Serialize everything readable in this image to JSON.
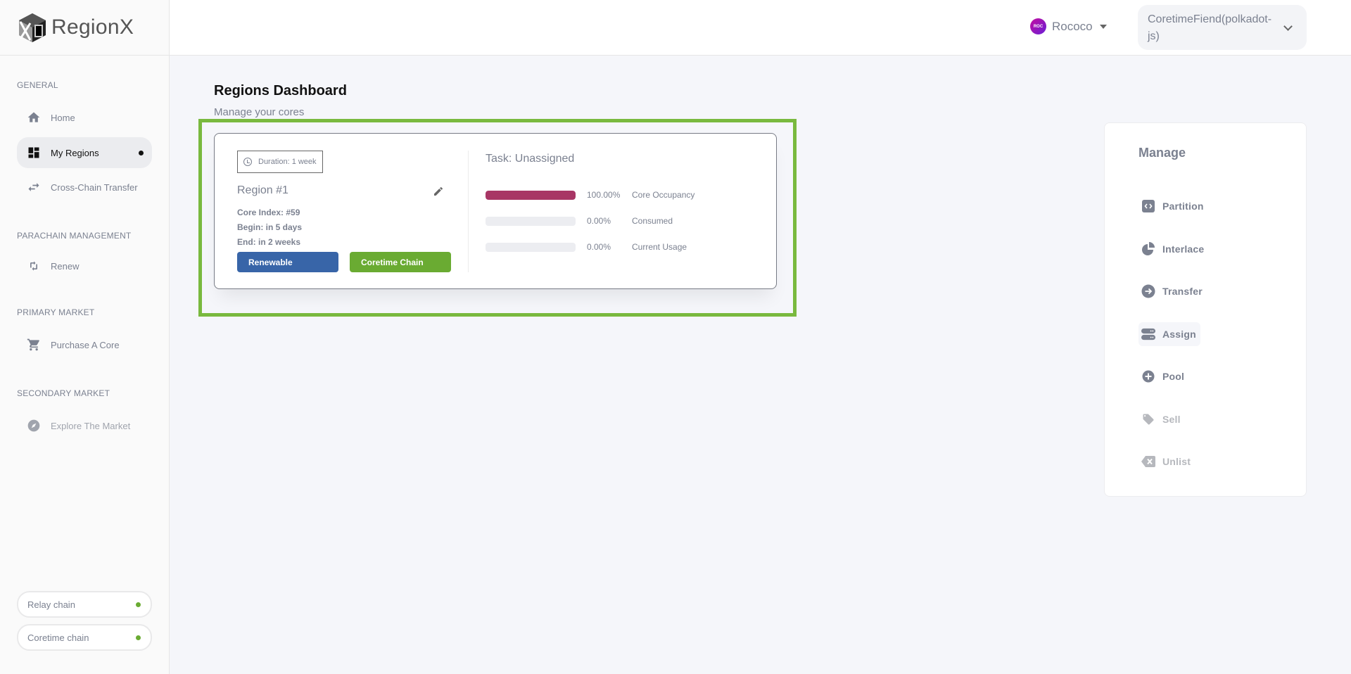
{
  "app": {
    "name": "RegionX"
  },
  "sidebar": {
    "sections": [
      {
        "label": "GENERAL",
        "items": [
          {
            "label": "Home",
            "icon": "home-icon"
          },
          {
            "label": "My Regions",
            "icon": "dashboard-icon",
            "active": true
          },
          {
            "label": "Cross-Chain Transfer",
            "icon": "swap-icon"
          }
        ]
      },
      {
        "label": "PARACHAIN MANAGEMENT",
        "items": [
          {
            "label": "Renew",
            "icon": "renew-icon"
          }
        ]
      },
      {
        "label": "PRIMARY MARKET",
        "items": [
          {
            "label": "Purchase A Core",
            "icon": "cart-icon"
          }
        ]
      },
      {
        "label": "SECONDARY MARKET",
        "items": [
          {
            "label": "Explore The Market",
            "icon": "compass-icon",
            "disabled": true
          }
        ]
      }
    ],
    "chains": [
      {
        "label": "Relay chain",
        "status": "connected",
        "status_color": "#6aab32"
      },
      {
        "label": "Coretime chain",
        "status": "connected",
        "status_color": "#6aab32"
      }
    ]
  },
  "topbar": {
    "network": {
      "label": "Rococo",
      "badge_text": "ROC"
    },
    "account": {
      "label": "CoretimeFiend(polkadot-js)"
    }
  },
  "page": {
    "title": "Regions Dashboard",
    "subtitle": "Manage your cores"
  },
  "region": {
    "duration": "Duration: 1 week",
    "name": "Region #1",
    "core_index": "Core Index: #59",
    "begin": "Begin: in 5 days",
    "end": "End: in 2 weeks",
    "tags": [
      {
        "label": "Renewable",
        "color": "#3865a8"
      },
      {
        "label": "Coretime Chain",
        "color": "#6aab32"
      }
    ],
    "task": "Task: Unassigned",
    "stats": [
      {
        "label": "Core Occupancy",
        "value": "100.00%",
        "fraction": 1.0
      },
      {
        "label": "Consumed",
        "value": "0.00%",
        "fraction": 0.0
      },
      {
        "label": "Current Usage",
        "value": "0.00%",
        "fraction": 0.0
      }
    ]
  },
  "manage": {
    "title": "Manage",
    "items": [
      {
        "label": "Partition",
        "icon": "partition-icon"
      },
      {
        "label": "Interlace",
        "icon": "pie-chart-icon"
      },
      {
        "label": "Transfer",
        "icon": "arrow-circle-icon"
      },
      {
        "label": "Assign",
        "icon": "storage-icon",
        "selected": true
      },
      {
        "label": "Pool",
        "icon": "plus-circle-icon"
      },
      {
        "label": "Sell",
        "icon": "tag-icon",
        "disabled": true
      },
      {
        "label": "Unlist",
        "icon": "backspace-icon",
        "disabled": true
      }
    ]
  },
  "colors": {
    "highlight": "#79b93e",
    "occupancy": "#a83665"
  }
}
